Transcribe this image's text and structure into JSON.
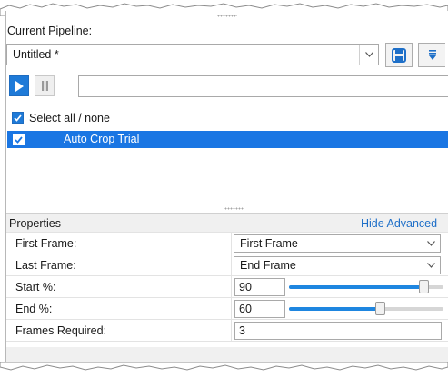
{
  "pipeline": {
    "section_label": "Current Pipeline:",
    "name_value": "Untitled *",
    "save_icon": "save-icon",
    "menu_icon": "menu-icon"
  },
  "run_controls": {
    "play_icon": "play-icon",
    "pause_icon": "pause-icon",
    "status_value": ""
  },
  "steps": {
    "select_all_label": "Select all / none",
    "items": [
      {
        "label": "Auto Crop Trial",
        "checked": true,
        "selected": true
      }
    ]
  },
  "properties": {
    "header": "Properties",
    "toggle_link": "Hide Advanced",
    "rows": [
      {
        "label": "First Frame:",
        "type": "select",
        "value": "First Frame"
      },
      {
        "label": "Last Frame:",
        "type": "select",
        "value": "End Frame"
      },
      {
        "label": "Start %:",
        "type": "slider",
        "value": "90",
        "percent": 90
      },
      {
        "label": "End %:",
        "type": "slider",
        "value": "60",
        "percent": 60
      },
      {
        "label": "Frames Required:",
        "type": "text",
        "value": "3"
      }
    ]
  },
  "colors": {
    "accent": "#1e7ad8",
    "selection": "#1a76e3",
    "link": "#1e6fc8"
  }
}
